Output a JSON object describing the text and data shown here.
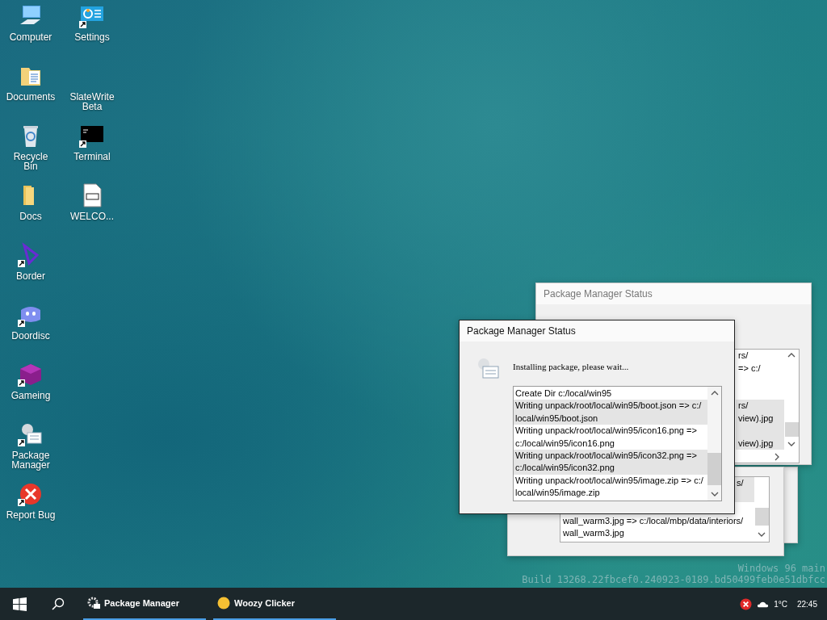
{
  "desktop_icons": [
    {
      "label": "Computer",
      "kind": "computer",
      "shortcut": false
    },
    {
      "label": "Documents",
      "kind": "documents",
      "shortcut": false
    },
    {
      "label": "Recycle Bin",
      "kind": "recycle",
      "shortcut": false
    },
    {
      "label": "Docs",
      "kind": "folder",
      "shortcut": false
    },
    {
      "label": "Border",
      "kind": "border",
      "shortcut": true
    },
    {
      "label": "Doordisc",
      "kind": "chat",
      "shortcut": true
    },
    {
      "label": "Gameing",
      "kind": "cube",
      "shortcut": true
    },
    {
      "label": "Package Manager",
      "kind": "package",
      "shortcut": true
    },
    {
      "label": "Report Bug",
      "kind": "bug",
      "shortcut": true
    },
    {
      "label": "Settings",
      "kind": "settings",
      "shortcut": true
    },
    {
      "label": "SlateWrite Beta",
      "kind": "blank",
      "shortcut": false
    },
    {
      "label": "Terminal",
      "kind": "terminal",
      "shortcut": true
    },
    {
      "label": "WELCO...",
      "kind": "markdown",
      "shortcut": false
    }
  ],
  "back_windows": [
    {
      "title": "Package Manager Status",
      "rows": [
        {
          "text": "rs/",
          "kind": "cut",
          "highlighted": false
        },
        {
          "text": "=> c:/",
          "kind": "cut",
          "highlighted": false
        },
        {
          "highlighted": false
        },
        {
          "highlighted": false
        },
        {
          "text": "rs/",
          "kind": "cut",
          "highlighted": true
        },
        {
          "text": "view).jpg",
          "kind": "cut",
          "highlighted": true
        },
        {
          "kind": "cut",
          "highlighted": true
        },
        {
          "text": "view).jpg",
          "kind": "cut",
          "highlighted": true
        }
      ]
    },
    {
      "rows": [
        {
          "text": "s/",
          "kind": "cut",
          "highlighted": true
        },
        {
          "kind": "cut",
          "highlighted": true
        },
        {
          "highlighted": false
        },
        {
          "text": "wall_warm3.jpg => c:/local/mbp/data/interiors/",
          "kind": "full",
          "highlighted": false
        },
        {
          "text": "wall_warm3.jpg",
          "kind": "full",
          "highlighted": false
        }
      ]
    }
  ],
  "dialog": {
    "title": "Package Manager Status",
    "message": "Installing package, please wait...",
    "log": [
      {
        "lines": [
          "Create Dir c:/local/win95"
        ],
        "highlighted": false
      },
      {
        "lines": [
          "Writing unpack/root/local/win95/boot.json => c:/",
          "local/win95/boot.json"
        ],
        "highlighted": true
      },
      {
        "lines": [
          "Writing unpack/root/local/win95/icon16.png =>",
          "c:/local/win95/icon16.png"
        ],
        "highlighted": false
      },
      {
        "lines": [
          "Writing unpack/root/local/win95/icon32.png =>",
          "c:/local/win95/icon32.png"
        ],
        "highlighted": true
      },
      {
        "lines": [
          "Writing unpack/root/local/win95/image.zip => c:/",
          "local/win95/image.zip"
        ],
        "highlighted": false
      }
    ]
  },
  "build_info": [
    "Windows 96 main",
    "Build 13268.22fbcef0.240923-0189.bd50499feb0e51dbfcc"
  ],
  "taskbar": {
    "tasks": [
      {
        "label": "Package Manager",
        "kind": "gear"
      },
      {
        "label": "Woozy Clicker",
        "kind": "smiley"
      }
    ],
    "temperature": "1°C",
    "time": "22:45"
  }
}
